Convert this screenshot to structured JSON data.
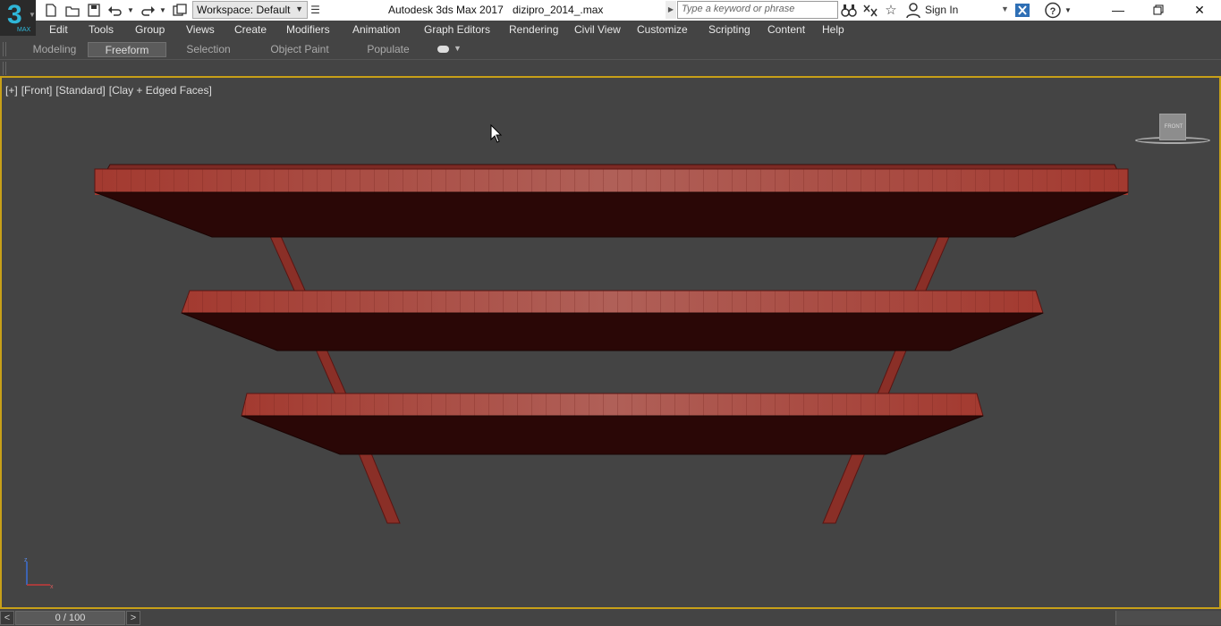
{
  "app": {
    "logo_number": "3",
    "logo_sub": "MAX",
    "title": "Autodesk 3ds Max 2017",
    "file_name": "dizipro_2014_.max"
  },
  "workspace": {
    "label": "Workspace: Default"
  },
  "search": {
    "placeholder": "Type a keyword or phrase"
  },
  "account": {
    "sign_in_label": "Sign In"
  },
  "menu": {
    "items": [
      "Edit",
      "Tools",
      "Group",
      "Views",
      "Create",
      "Modifiers",
      "Animation",
      "Graph Editors",
      "Rendering",
      "Civil View",
      "Customize",
      "Scripting",
      "Content",
      "Help"
    ]
  },
  "ribbon": {
    "tabs": [
      "Modeling",
      "Freeform",
      "Selection",
      "Object Paint",
      "Populate"
    ],
    "active_tab": "Freeform"
  },
  "viewport": {
    "labels": [
      "[+]",
      "[Front]",
      "[Standard]",
      "[Clay + Edged Faces]"
    ],
    "viewcube_label": "FRONT",
    "border_color": "#c8a018",
    "object_color": "#a8453d"
  },
  "timeline": {
    "frame_display": "0 / 100",
    "prev_label": "<",
    "next_label": ">"
  },
  "icons": {
    "toolbar": [
      "new-file-icon",
      "open-file-icon",
      "save-icon",
      "undo-icon",
      "redo-icon",
      "project-folder-icon"
    ],
    "info": [
      "binoculars-icon",
      "exchange-icon",
      "star-icon",
      "user-icon",
      "x-icon",
      "help-icon"
    ]
  }
}
